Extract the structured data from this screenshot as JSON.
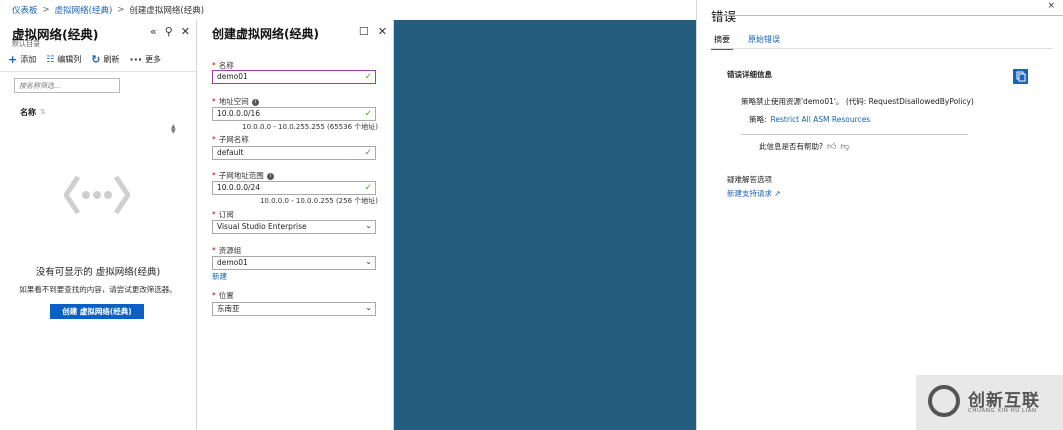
{
  "breadcrumb": {
    "items": [
      "仪表板",
      "虚拟网络(经典)",
      "创建虚拟网络(经典)"
    ],
    "separator": ">"
  },
  "left_blade": {
    "title": "虚拟网络(经典)",
    "subtitle": "默认目录",
    "toolbar": {
      "add": "添加",
      "edit_columns": "编辑列",
      "refresh": "刷新",
      "more": "更多"
    },
    "filter_placeholder": "按名称筛选...",
    "column_name": "名称",
    "empty_title": "没有可显示的 虚拟网络(经典)",
    "empty_desc": "如果看不到要查找的内容，请尝试更改筛选器。",
    "create_button": "创建 虚拟网络(经典)"
  },
  "create_blade": {
    "title": "创建虚拟网络(经典)",
    "fields": {
      "name": {
        "label": "名称",
        "value": "demo01"
      },
      "address_space": {
        "label": "地址空间",
        "value": "10.0.0.0/16",
        "hint": "10.0.0.0 - 10.0.255.255 (65536 个地址)"
      },
      "subnet_name": {
        "label": "子网名称",
        "value": "default"
      },
      "subnet_range": {
        "label": "子网地址范围",
        "value": "10.0.0.0/24",
        "hint": "10.0.0.0 - 10.0.0.255 (256 个地址)"
      },
      "subscription": {
        "label": "订阅",
        "value": "Visual Studio Enterprise"
      },
      "resource_group": {
        "label": "资源组",
        "value": "demo01",
        "new_link": "新建"
      },
      "location": {
        "label": "位置",
        "value": "东南亚"
      }
    }
  },
  "error_panel": {
    "title": "错误",
    "close": "×",
    "tabs": [
      "摘要",
      "原始错误"
    ],
    "details_heading": "错误详细信息",
    "message": "策略禁止使用资源'demo01'。 (代码: RequestDisallowedByPolicy)",
    "policy_label": "策略:",
    "policy_link": "Restrict All ASM Resources",
    "helpful_question": "此信息是否有帮助?",
    "troubleshoot_heading": "疑难解答选项",
    "support_link": "新建支持请求"
  },
  "watermark": {
    "text": "创新互联",
    "sub": "CHUANG XIN HU LIAN"
  },
  "colors": {
    "link": "#1a63b5",
    "primary_button": "#0a60c5",
    "backdrop": "#255d80",
    "valid_check": "#4ba32a",
    "active_border": "#9a3db0"
  }
}
